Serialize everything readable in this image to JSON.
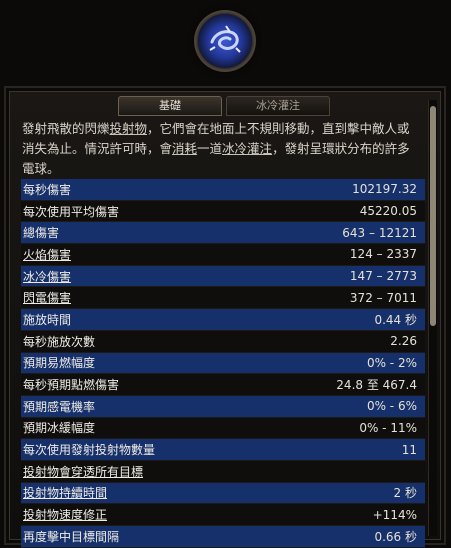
{
  "tabs": [
    "基礎",
    "冰冷灌注"
  ],
  "description": {
    "line1_a": "發射飛散的閃爍",
    "line1_b": "投射物",
    "line1_c": "，它們會在地面上不規則移動，直到擊中敵人或",
    "line2": "消失為止。情況許可時，會",
    "line2_u1": "消耗",
    "line2_b": "一道",
    "line2_u2": "冰冷灌注",
    "line2_c": "，發射呈環狀分布的許多",
    "line3": "電球。"
  },
  "stats": [
    {
      "label": "每秒傷害",
      "value": "102197.32"
    },
    {
      "label": "每次使用平均傷害",
      "value": "45220.05"
    },
    {
      "label": "總傷害",
      "value": "643 – 12121"
    },
    {
      "label": "火焰傷害",
      "value": "124 – 2337"
    },
    {
      "label": "冰冷傷害",
      "value": "147 – 2773"
    },
    {
      "label": "閃電傷害",
      "value": "372 – 7011"
    },
    {
      "label": "施放時間",
      "value": "0.44 秒"
    },
    {
      "label": "每秒施放次數",
      "value": "2.26"
    },
    {
      "label": "預期易燃幅度",
      "value": "0% - 2%"
    },
    {
      "label": "每秒預期點燃傷害",
      "value": "24.8 至 467.4"
    },
    {
      "label": "預期感電機率",
      "value": "0% - 6%"
    },
    {
      "label": "預期冰緩幅度",
      "value": "0% - 11%"
    },
    {
      "label": "每次使用發射投射物數量",
      "value": "11"
    },
    {
      "label": "投射物會穿透所有目標",
      "value": ""
    },
    {
      "label": "投射物持續時間",
      "value": "2 秒"
    },
    {
      "label": "投射物速度修正",
      "value": "+114%"
    },
    {
      "label": "再度擊中目標間隔",
      "value": "0.66 秒"
    }
  ]
}
